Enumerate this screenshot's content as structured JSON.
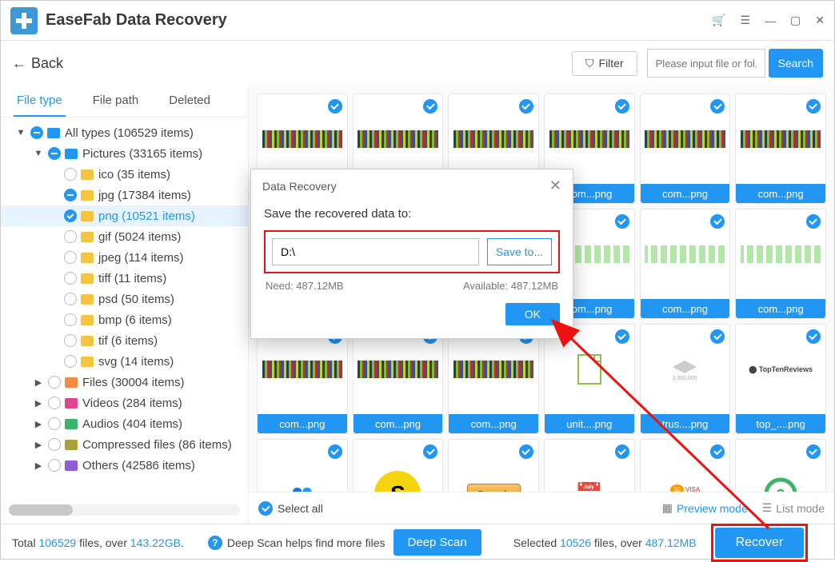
{
  "app": {
    "title": "EaseFab Data Recovery"
  },
  "toolbar": {
    "back": "Back",
    "filter": "Filter",
    "search_placeholder": "Please input file or fol...",
    "search_btn": "Search"
  },
  "tabs": {
    "file_type": "File type",
    "file_path": "File path",
    "deleted": "Deleted"
  },
  "tree": {
    "all_types": "All types (106529 items)",
    "pictures": "Pictures (33165 items)",
    "ico": "ico (35 items)",
    "jpg": "jpg (17384 items)",
    "png": "png (10521 items)",
    "gif": "gif (5024 items)",
    "jpeg": "jpeg (114 items)",
    "tiff": "tiff (11 items)",
    "psd": "psd (50 items)",
    "bmp": "bmp (6 items)",
    "tif": "tif (6 items)",
    "svg": "svg (14 items)",
    "files": "Files (30004 items)",
    "videos": "Videos (284 items)",
    "audios": "Audios (404 items)",
    "compressed": "Compressed files (86 items)",
    "others": "Others (42586 items)"
  },
  "thumbs": {
    "generic": "com...png",
    "unit": "unit....png",
    "trus": "trus....png",
    "top": "top_....png"
  },
  "contentfooter": {
    "select_all": "Select all",
    "preview": "Preview mode",
    "list": "List mode"
  },
  "status": {
    "total_pre": "Total ",
    "total_count": "106529",
    "total_mid": " files, over ",
    "total_size": "143.22GB",
    "dot": ".",
    "deep_help": "Deep Scan helps find more files",
    "deep_btn": "Deep Scan",
    "selected_pre": "Selected ",
    "selected_count": "10526",
    "selected_mid": " files, over ",
    "selected_size": "487.12MB",
    "recover": "Recover"
  },
  "dialog": {
    "title": "Data Recovery",
    "prompt": "Save the recovered data to:",
    "dest": "D:\\",
    "saveto": "Save to...",
    "need": "Need: 487.12MB",
    "available": "Available: 487.12MB",
    "ok": "OK"
  }
}
